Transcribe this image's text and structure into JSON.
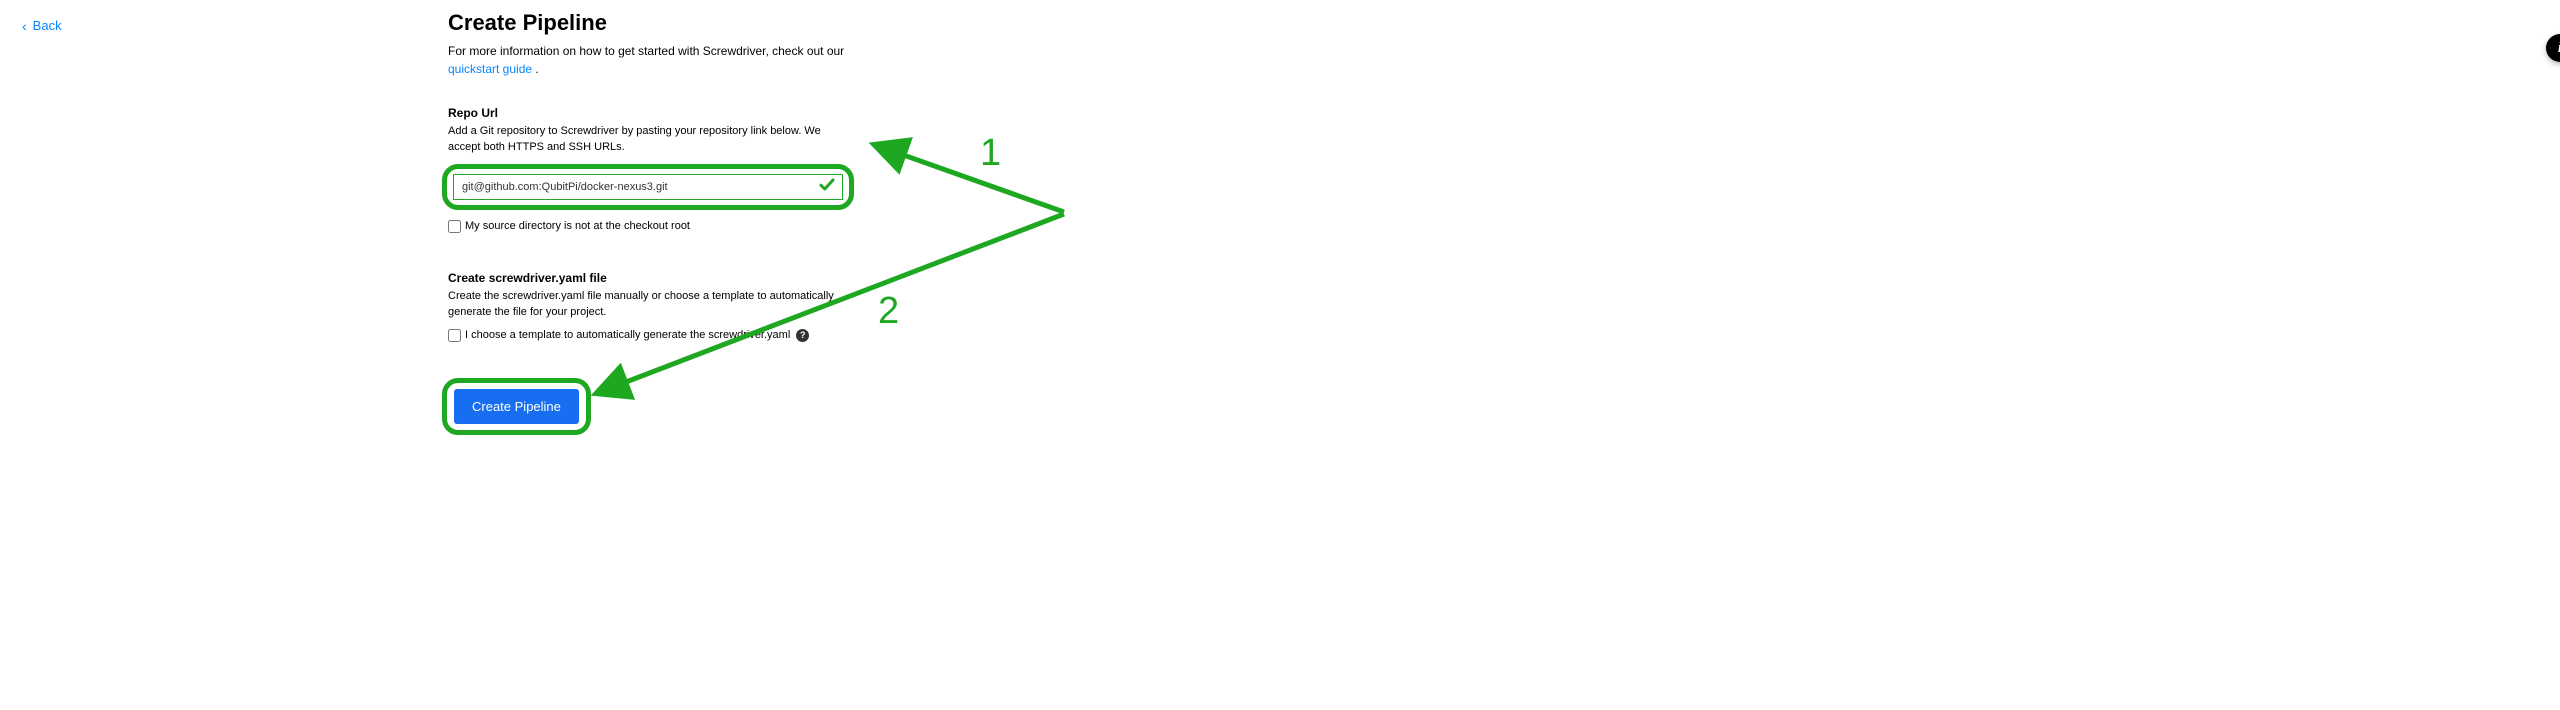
{
  "back": {
    "label": "Back"
  },
  "page": {
    "title": "Create Pipeline",
    "intro_prefix": "For more information on how to get started with Screwdriver, check out our ",
    "intro_link": "quickstart guide",
    "intro_suffix": " ."
  },
  "repo": {
    "label": "Repo Url",
    "desc": "Add a Git repository to Screwdriver by pasting your repository link below. We accept both HTTPS and SSH URLs.",
    "value": "git@github.com:QubitPi/docker-nexus3.git",
    "checkbox_label": "My source directory is not at the checkout root"
  },
  "yaml": {
    "label": "Create screwdriver.yaml file",
    "desc": "Create the screwdriver.yaml file manually or choose a template to automatically generate the file for your project.",
    "checkbox_label": "I choose a template to automatically generate the screwdriver.yaml"
  },
  "button": {
    "create": "Create Pipeline"
  },
  "annotations": {
    "one": "1",
    "two": "2"
  },
  "info_tooltip": "i"
}
